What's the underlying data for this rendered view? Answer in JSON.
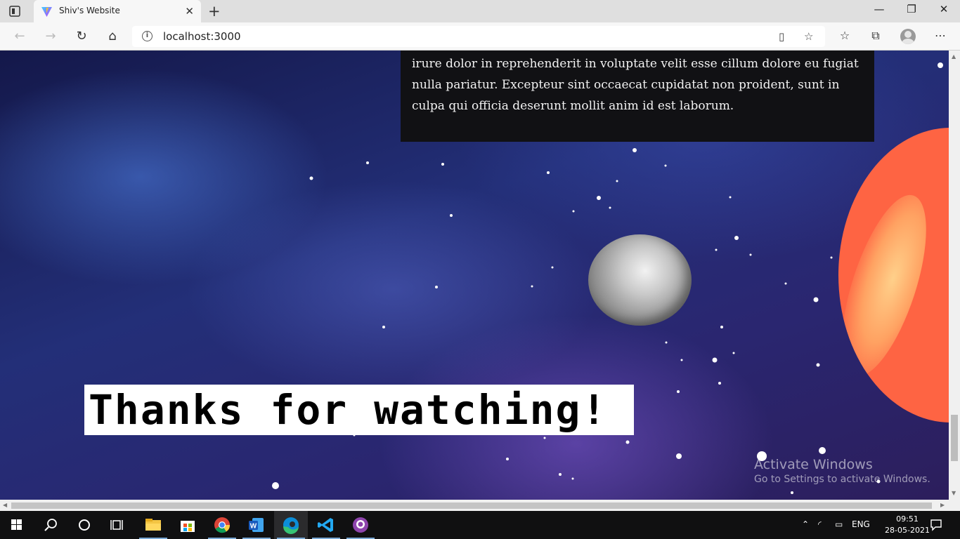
{
  "browser": {
    "tab_title": "Shiv's Website",
    "tab_close": "✕",
    "new_tab": "+",
    "url": "localhost:3000",
    "window_controls": [
      "—",
      "❐",
      "✕"
    ],
    "nav": {
      "back": "←",
      "forward": "→",
      "refresh": "↻",
      "home": "⌂"
    },
    "toolbar_icons": [
      "favorites-list-icon",
      "collections-icon",
      "profile-icon",
      "more-icon"
    ]
  },
  "page": {
    "paragraph": "irure dolor in reprehenderit in voluptate velit esse cillum dolore eu fugiat nulla pariatur. Excepteur sint occaecat cupidatat non proident, sunt in culpa qui officia deserunt mollit anim id est laborum.",
    "thanks_heading": "Thanks for watching!",
    "watermark_title": "Activate Windows",
    "watermark_subtitle": "Go to Settings to activate Windows."
  },
  "colors": {
    "planet": "#fe6443",
    "panel": "#111114",
    "space": "#232f78"
  },
  "taskbar": {
    "apps": [
      "start-icon",
      "search-icon",
      "cortana-icon",
      "task-view-icon",
      "file-explorer-icon",
      "store-icon",
      "chrome-icon",
      "word-icon",
      "edge-icon",
      "vscode-icon",
      "github-desktop-icon"
    ],
    "language": "ENG",
    "time": "09:51",
    "date": "28-05-2021"
  }
}
